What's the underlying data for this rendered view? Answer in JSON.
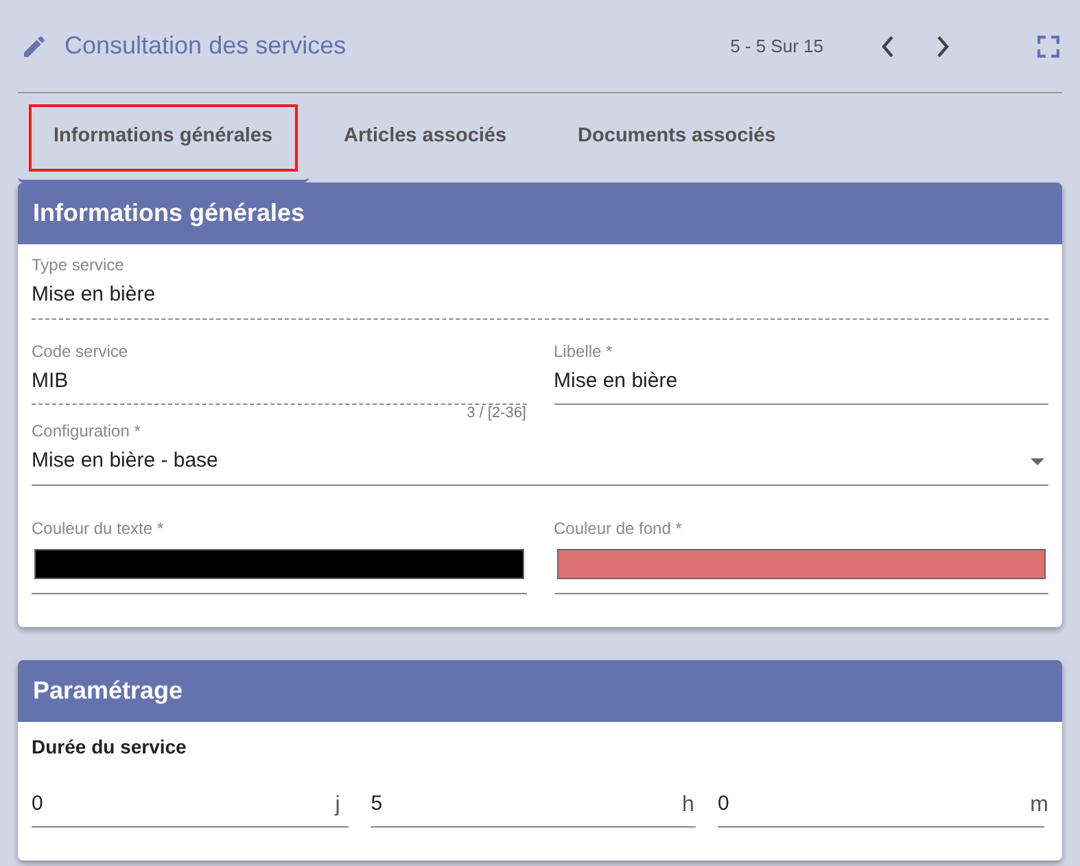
{
  "header": {
    "title": "Consultation des services",
    "pager": "5 - 5 Sur 15"
  },
  "tabs": [
    {
      "label": "Informations générales",
      "selected": true,
      "highlighted": true
    },
    {
      "label": "Articles associés",
      "selected": false,
      "highlighted": false
    },
    {
      "label": "Documents associés",
      "selected": false,
      "highlighted": false
    }
  ],
  "general": {
    "title": "Informations générales",
    "type_service": {
      "label": "Type service",
      "value": "Mise en bière",
      "readonly": true
    },
    "code_service": {
      "label": "Code service",
      "value": "MIB",
      "readonly": true,
      "counter": "3 / [2-36]"
    },
    "libelle": {
      "label": "Libelle *",
      "value": "Mise en bière",
      "readonly": false
    },
    "configuration": {
      "label": "Configuration *",
      "value": "Mise en bière - base"
    },
    "text_color": {
      "label": "Couleur du texte *",
      "color": "#000000"
    },
    "background_color": {
      "label": "Couleur de fond *",
      "color": "#de7272"
    }
  },
  "settings": {
    "title": "Paramétrage",
    "subtitle": "Durée du service",
    "duration": [
      {
        "value": "0",
        "unit": "j"
      },
      {
        "value": "5",
        "unit": "h"
      },
      {
        "value": "0",
        "unit": "m"
      }
    ]
  }
}
